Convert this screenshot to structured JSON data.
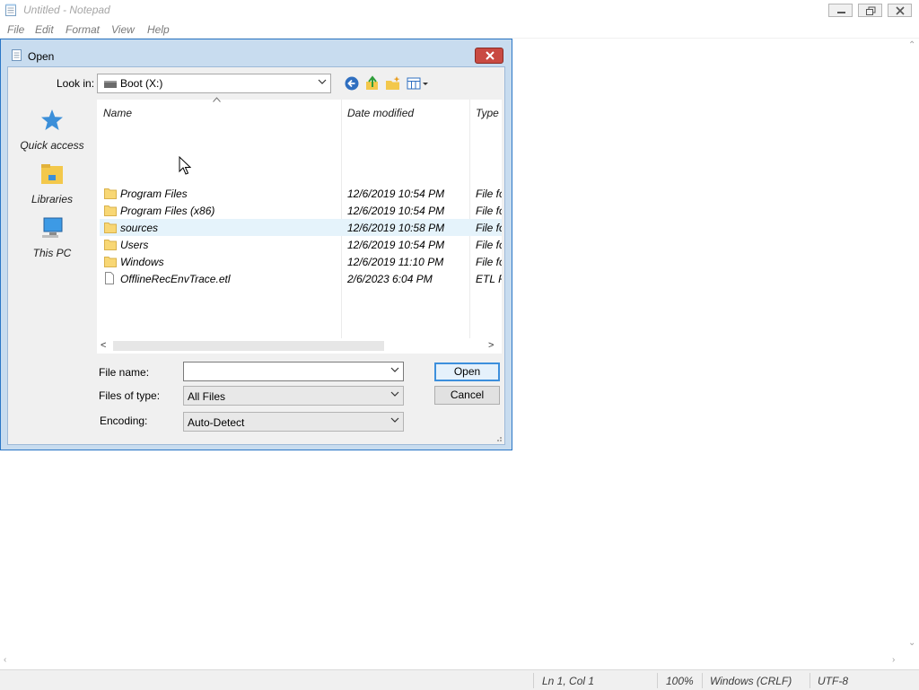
{
  "notepad": {
    "title": "Untitled - Notepad",
    "menu": [
      "File",
      "Edit",
      "Format",
      "View",
      "Help"
    ],
    "status": {
      "position": "Ln 1, Col 1",
      "zoom": "100%",
      "line_ending": "Windows (CRLF)",
      "encoding": "UTF-8"
    }
  },
  "dialog": {
    "title": "Open",
    "look_in_label": "Look in:",
    "look_in_value": "Boot (X:)",
    "places": [
      {
        "label": "Quick access",
        "icon": "star-icon"
      },
      {
        "label": "Libraries",
        "icon": "libraries-icon"
      },
      {
        "label": "This PC",
        "icon": "computer-icon"
      }
    ],
    "columns": {
      "name": "Name",
      "date": "Date modified",
      "type": "Type"
    },
    "files": [
      {
        "name": "Program Files",
        "date": "12/6/2019 10:54 PM",
        "type": "File fo",
        "kind": "folder"
      },
      {
        "name": "Program Files (x86)",
        "date": "12/6/2019 10:54 PM",
        "type": "File fo",
        "kind": "folder"
      },
      {
        "name": "sources",
        "date": "12/6/2019 10:58 PM",
        "type": "File fo",
        "kind": "folder"
      },
      {
        "name": "Users",
        "date": "12/6/2019 10:54 PM",
        "type": "File fo",
        "kind": "folder"
      },
      {
        "name": "Windows",
        "date": "12/6/2019 11:10 PM",
        "type": "File fo",
        "kind": "folder"
      },
      {
        "name": "OfflineRecEnvTrace.etl",
        "date": "2/6/2023 6:04 PM",
        "type": "ETL F",
        "kind": "file"
      }
    ],
    "hover_row": 2,
    "file_name_label": "File name:",
    "file_name_value": "",
    "files_of_type_label": "Files of type:",
    "files_of_type_value": "All Files",
    "encoding_label": "Encoding:",
    "encoding_value": "Auto-Detect",
    "open_button": "Open",
    "cancel_button": "Cancel"
  },
  "colors": {
    "dialog_frame": "#c8dcef",
    "close_button": "#c94a42",
    "hover_row": "#e5f3fb",
    "folder": "#f8d775"
  }
}
